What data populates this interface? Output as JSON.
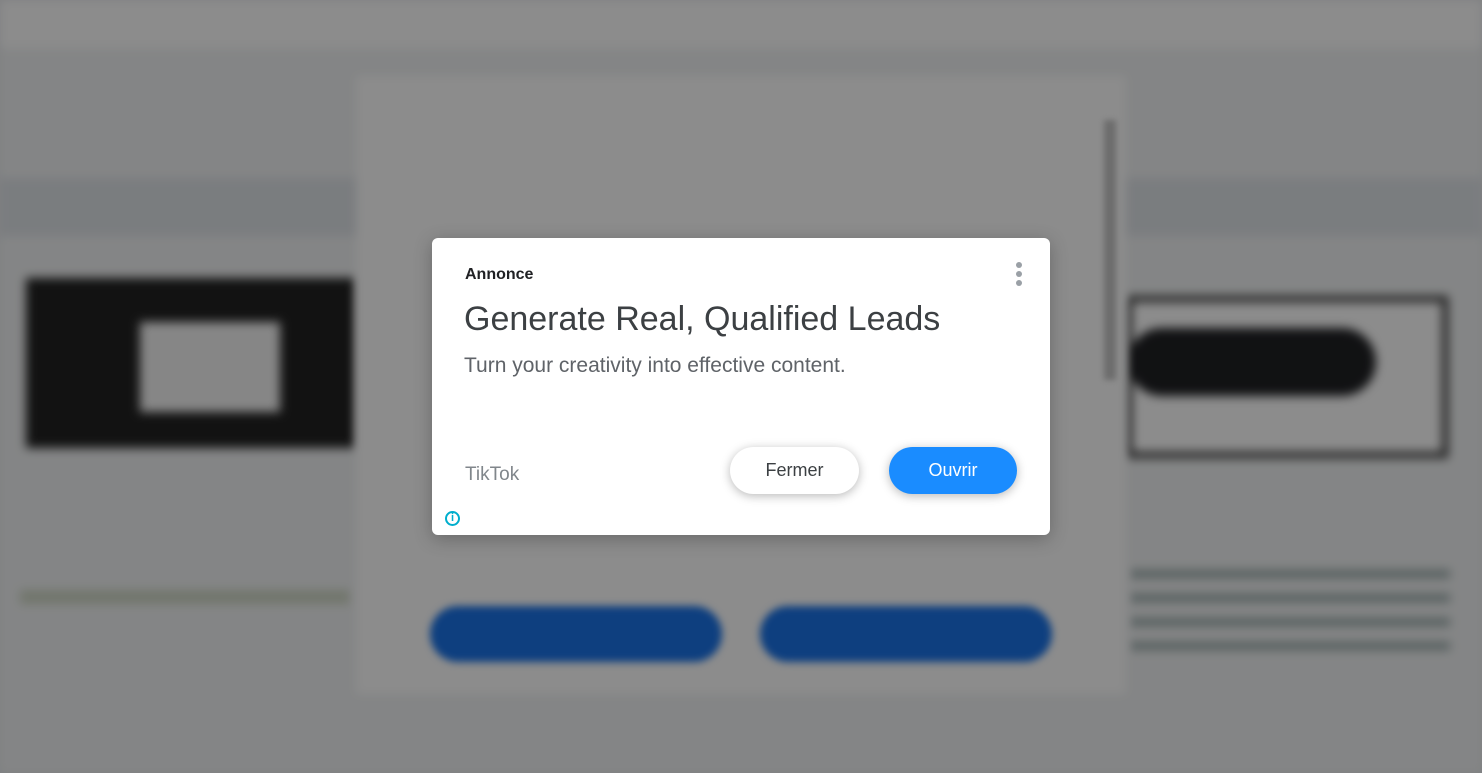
{
  "ad": {
    "label": "Annonce",
    "headline": "Generate Real, Qualified Leads",
    "description": "Turn your creativity into effective content.",
    "advertiser": "TikTok",
    "close_label": "Fermer",
    "open_label": "Ouvrir",
    "menu_icon": "more-vert-icon",
    "info_icon": "info-icon"
  },
  "colors": {
    "accent": "#1a8cff",
    "info": "#00aecd",
    "overlay": "rgba(0,0,0,0.45)"
  }
}
